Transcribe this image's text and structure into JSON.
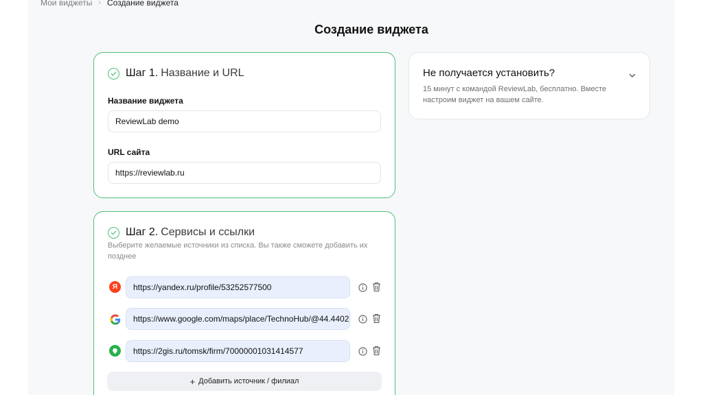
{
  "breadcrumb": {
    "parent": "Мои виджеты",
    "separator": "›",
    "current": "Создание виджета"
  },
  "page_title": "Создание виджета",
  "step1": {
    "number": "Шаг 1.",
    "name": "Название и URL",
    "name_label": "Название виджета",
    "name_value": "ReviewLab demo",
    "url_label": "URL сайта",
    "url_value": "https://reviewlab.ru"
  },
  "step2": {
    "number": "Шаг 2.",
    "name": "Сервисы и ссылки",
    "subtitle": "Выберите желаемые источники из списка. Вы также сможете добавить их позднее",
    "sources": [
      {
        "icon": "yandex-icon",
        "glyph": "Я",
        "color": "#fc3f1d",
        "url": "https://yandex.ru/profile/53252577500"
      },
      {
        "icon": "google-icon",
        "glyph": "G",
        "color": "#4285f4",
        "url": "https://www.google.com/maps/place/TechnoHub/@44.4402"
      },
      {
        "icon": "2gis-icon",
        "glyph": "",
        "color": "#29b24a",
        "url": "https://2gis.ru/tomsk/firm/70000001031414577"
      }
    ],
    "add_label": "Добавить источник / филиал"
  },
  "help": {
    "title": "Не получается установить?",
    "text": "15 минут с командой ReviewLab, бесплатно. Вместе настроим виджет на вашем сайте."
  },
  "colors": {
    "accent_green": "#4cbf74",
    "url_field_bg": "#e9effc",
    "page_bg": "#f7f8fa"
  }
}
